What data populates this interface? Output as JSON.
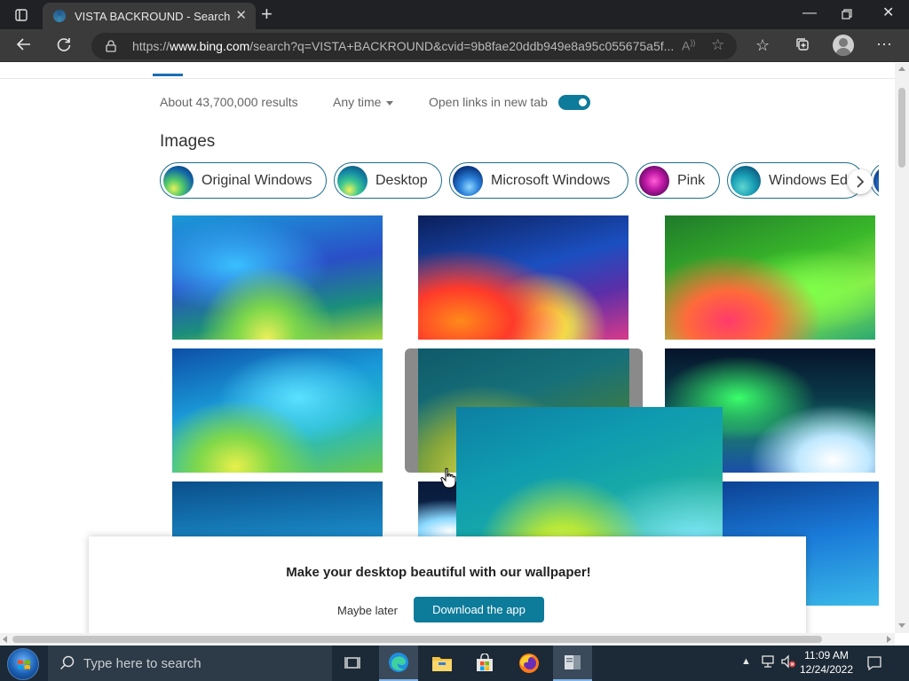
{
  "browser": {
    "tab_title": "VISTA BACKROUND - Search",
    "url_prefix": "https://",
    "url_host": "www.bing.com",
    "url_rest": "/search?q=VISTA+BACKROUND&cvid=9b8fae20ddb949e8a95c055675a5f...",
    "icons": [
      "tab-actions-icon",
      "close-tab-icon",
      "new-tab-icon",
      "minimize-icon",
      "restore-icon",
      "close-window-icon",
      "back-icon",
      "refresh-icon",
      "lock-icon",
      "read-aloud-icon",
      "add-favorite-icon",
      "favorites-icon",
      "collections-icon",
      "profile-icon",
      "more-icon"
    ]
  },
  "search": {
    "results_count": "About 43,700,000 results",
    "time_filter": "Any time",
    "open_links_label": "Open links in new tab",
    "open_links_on": true
  },
  "images": {
    "heading": "Images",
    "chips": [
      {
        "label": "Original Windows"
      },
      {
        "label": "Desktop"
      },
      {
        "label": "Microsoft Windows"
      },
      {
        "label": "Pink"
      },
      {
        "label": "Windows Ed"
      }
    ]
  },
  "banner": {
    "message": "Make your desktop beautiful with our wallpaper!",
    "maybe_label": "Maybe later",
    "download_label": "Download the app"
  },
  "taskbar": {
    "search_placeholder": "Type here to search",
    "time": "11:09 AM",
    "date": "12/24/2022"
  }
}
